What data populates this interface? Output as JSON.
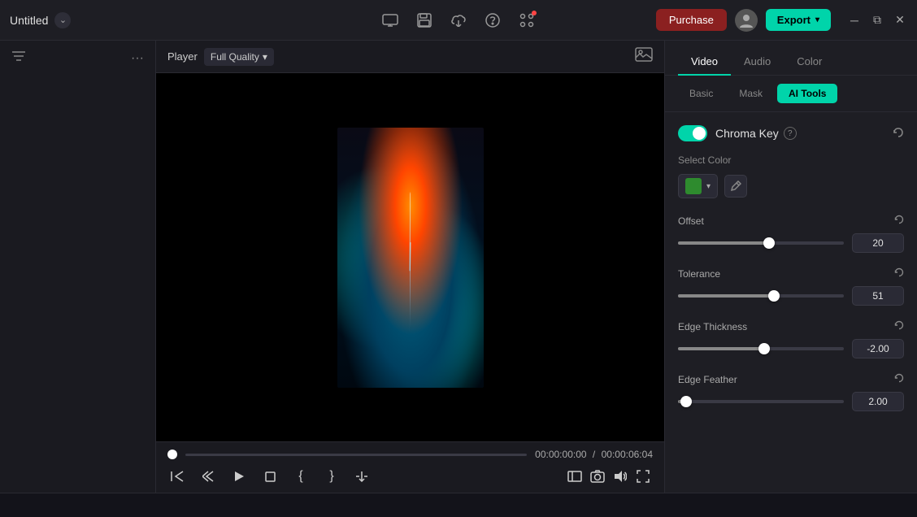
{
  "titlebar": {
    "app_title": "Untitled",
    "purchase_label": "Purchase",
    "export_label": "Export",
    "avatar_icon": "👤"
  },
  "player": {
    "label": "Player",
    "quality": "Full Quality",
    "time_current": "00:00:00:00",
    "time_separator": "/",
    "time_total": "00:00:06:04"
  },
  "tabs": {
    "video": "Video",
    "audio": "Audio",
    "color": "Color",
    "basic": "Basic",
    "mask": "Mask",
    "ai_tools": "AI Tools"
  },
  "chroma": {
    "label": "Chroma Key",
    "enabled": true
  },
  "select_color": {
    "label": "Select Color"
  },
  "offset": {
    "label": "Offset",
    "value": "20",
    "percent": 55
  },
  "tolerance": {
    "label": "Tolerance",
    "value": "51",
    "percent": 58
  },
  "edge_thickness": {
    "label": "Edge Thickness",
    "value": "-2.00",
    "percent": 52
  },
  "edge_feather": {
    "label": "Edge Feather",
    "value": "2.00",
    "percent": 5
  }
}
